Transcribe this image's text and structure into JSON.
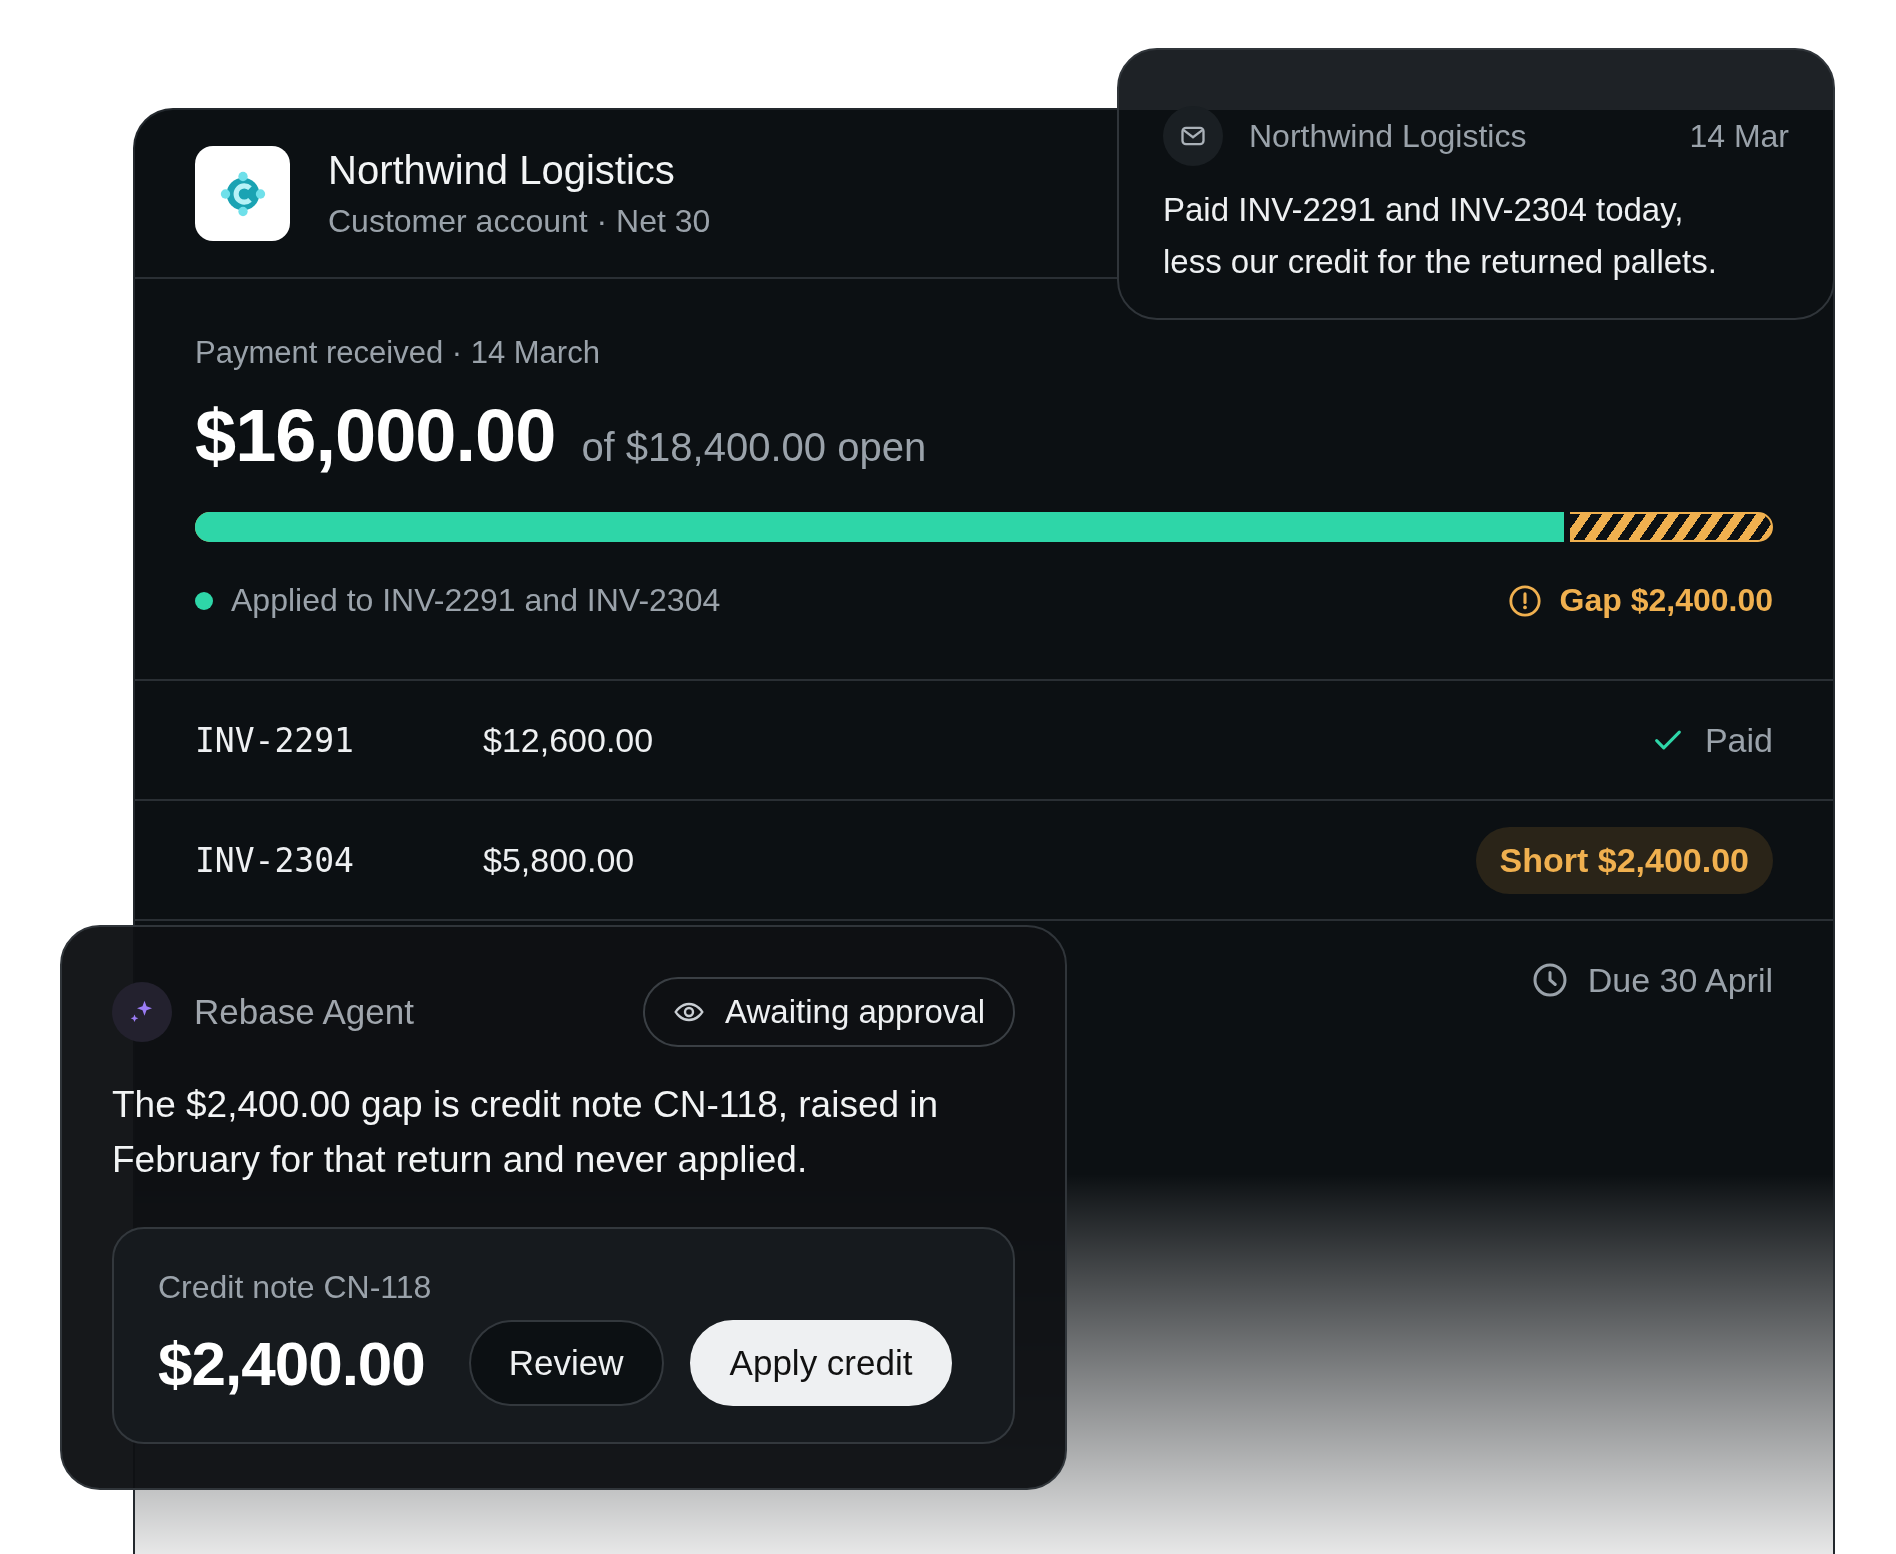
{
  "account": {
    "name": "Northwind Logistics",
    "subtitle": "Customer account · Net 30"
  },
  "payment": {
    "label": "Payment received · 14 March",
    "amount": "$16,000.00",
    "open": "of $18,400.00 open",
    "level": 0.87,
    "applied": "Applied to INV-2291 and INV-2304",
    "gap": "Gap $2,400.00"
  },
  "invoices": [
    {
      "number": "INV-2291",
      "amount": "$12,600.00",
      "kind": "paid",
      "status": "Paid"
    },
    {
      "number": "INV-2304",
      "amount": "$5,800.00",
      "kind": "short",
      "status": "Short $2,400.00"
    },
    {
      "kind": "due",
      "status": "Due 30 April"
    }
  ],
  "message": {
    "sender": "Northwind Logistics",
    "date": "14 Mar",
    "body": "Paid INV-2291 and INV-2304 today, less our credit for the returned pallets."
  },
  "agent": {
    "name": "Rebase Agent",
    "status": "Awaiting approval",
    "body": "The $2,400.00 gap is credit note CN-118, raised in February for that return and never applied.",
    "credit": {
      "label": "Credit note CN-118",
      "amount": "$2,400.00",
      "buttons": [
        {
          "label": "Review",
          "kind": "secondary"
        },
        {
          "label": "Apply credit",
          "kind": "primary"
        }
      ]
    }
  }
}
